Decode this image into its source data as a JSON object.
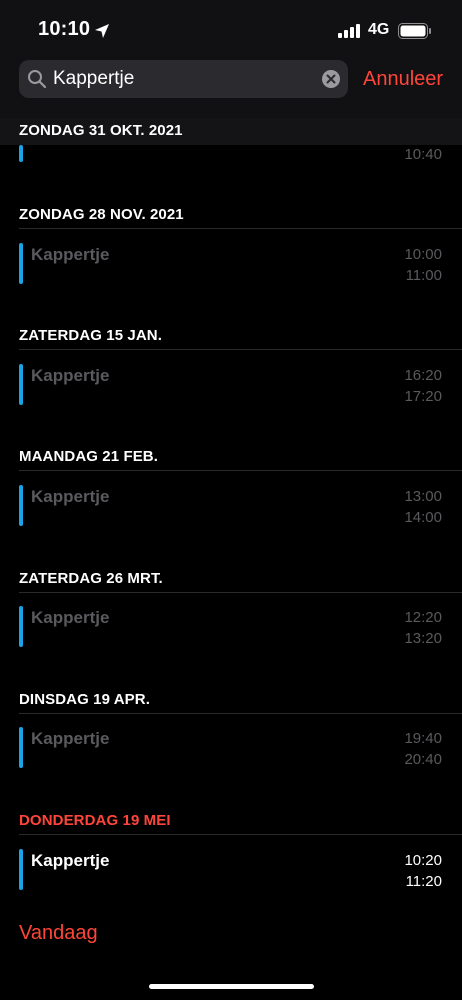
{
  "status_bar": {
    "time": "10:10",
    "network": "4G"
  },
  "search": {
    "value": "Kappertje",
    "cancel_label": "Annuleer"
  },
  "sections": [
    {
      "header": "ZONDAG 31 OKT. 2021",
      "partial_end": "10:40"
    },
    {
      "header": "ZONDAG 28 NOV. 2021",
      "event": {
        "title": "Kappertje",
        "start": "10:00",
        "end": "11:00"
      }
    },
    {
      "header": "ZATERDAG 15 JAN.",
      "event": {
        "title": "Kappertje",
        "start": "16:20",
        "end": "17:20"
      }
    },
    {
      "header": "MAANDAG 21 FEB.",
      "event": {
        "title": "Kappertje",
        "start": "13:00",
        "end": "14:00"
      }
    },
    {
      "header": "ZATERDAG 26 MRT.",
      "event": {
        "title": "Kappertje",
        "start": "12:20",
        "end": "13:20"
      }
    },
    {
      "header": "DINSDAG 19 APR.",
      "event": {
        "title": "Kappertje",
        "start": "19:40",
        "end": "20:40"
      }
    },
    {
      "header": "DONDERDAG 19 MEI",
      "event": {
        "title": "Kappertje",
        "start": "10:20",
        "end": "11:20"
      }
    }
  ],
  "today_label": "Vandaag",
  "colors": {
    "accent_red": "#ff453a",
    "calendar_blue": "#1aa3e8",
    "past_text": "#5a5a5e"
  }
}
